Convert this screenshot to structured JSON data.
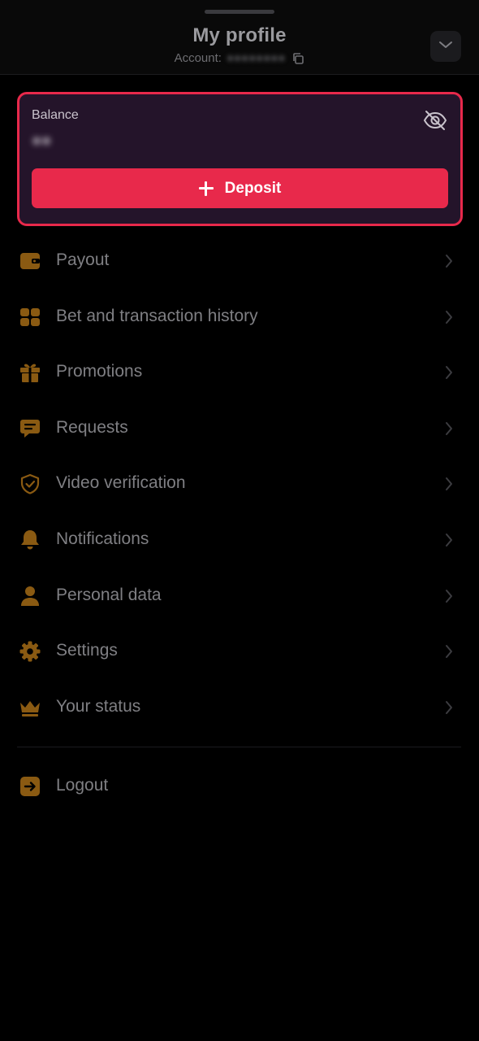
{
  "header": {
    "title": "My profile",
    "account_label": "Account:",
    "account_id": "●●●●●●●●"
  },
  "balance": {
    "label": "Balance",
    "value": "●●",
    "deposit_label": "Deposit"
  },
  "menu": [
    {
      "label": "Payout",
      "icon": "wallet-icon"
    },
    {
      "label": "Bet and transaction history",
      "icon": "history-icon"
    },
    {
      "label": "Promotions",
      "icon": "gift-icon"
    },
    {
      "label": "Requests",
      "icon": "chat-icon"
    },
    {
      "label": "Video verification",
      "icon": "shield-check-icon"
    },
    {
      "label": "Notifications",
      "icon": "bell-icon"
    },
    {
      "label": "Personal data",
      "icon": "user-icon"
    },
    {
      "label": "Settings",
      "icon": "gear-icon"
    },
    {
      "label": "Your status",
      "icon": "crown-icon"
    }
  ],
  "logout": {
    "label": "Logout",
    "icon": "logout-icon"
  },
  "colors": {
    "accent": "#e8294b",
    "card_bg": "#24142a",
    "icon": "#8a5a12",
    "text": "#7f7f83",
    "background": "#000000"
  }
}
